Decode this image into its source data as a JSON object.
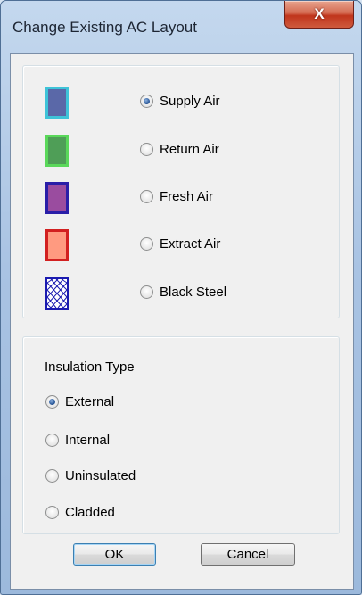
{
  "window": {
    "title": "Change Existing AC Layout",
    "close_label": "X"
  },
  "duct_types": [
    {
      "label": "Supply Air",
      "checked": true,
      "fill": "#5a68a8",
      "border": "#3ec3d8"
    },
    {
      "label": "Return Air",
      "checked": false,
      "fill": "#4f9e57",
      "border": "#5ad85a"
    },
    {
      "label": "Fresh Air",
      "checked": false,
      "fill": "#9a4c9f",
      "border": "#2a1ea8"
    },
    {
      "label": "Extract Air",
      "checked": false,
      "fill": "#ff9a80",
      "border": "#d22020"
    },
    {
      "label": "Black Steel",
      "checked": false,
      "fill": "#ffffff",
      "border": "#1a1ab0"
    }
  ],
  "insulation": {
    "heading": "Insulation Type",
    "options": [
      {
        "label": "External",
        "checked": true
      },
      {
        "label": "Internal",
        "checked": false
      },
      {
        "label": "Uninsulated",
        "checked": false
      },
      {
        "label": "Cladded",
        "checked": false
      }
    ]
  },
  "buttons": {
    "ok": "OK",
    "cancel": "Cancel"
  }
}
